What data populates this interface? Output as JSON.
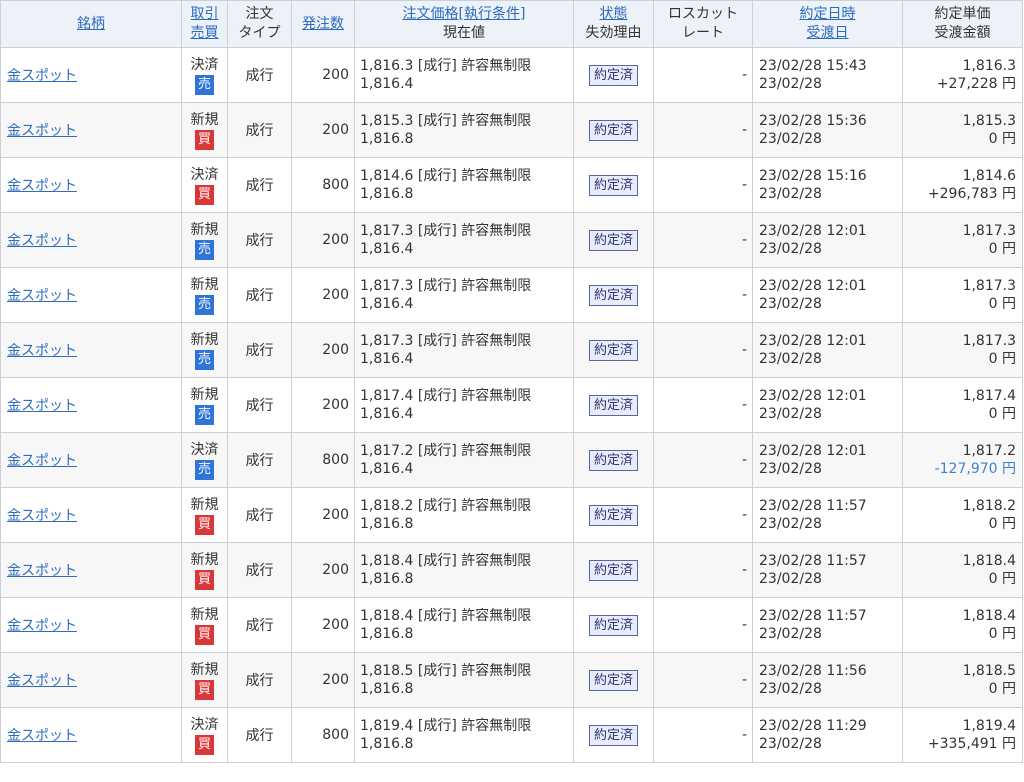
{
  "headers": {
    "symbol": "銘柄",
    "trade_line1": "取引",
    "trade_line2": "売買",
    "type_line1": "注文",
    "type_line2": "タイプ",
    "qty": "発注数",
    "price_line1": "注文価格[執行条件]",
    "price_line2": "現在値",
    "status_line1": "状態",
    "status_line2": "失効理由",
    "loss_line1": "ロスカット",
    "loss_line2": "レート",
    "date_line1": "約定日時",
    "date_line2": "受渡日",
    "amt_line1": "約定単価",
    "amt_line2": "受渡金額"
  },
  "colors": {
    "sell_badge": "#2f74d6",
    "buy_badge": "#d9383a",
    "link": "#2d6cc0",
    "negative": "#3b82d6"
  },
  "rows": [
    {
      "symbol": "金スポット",
      "trade": "決済",
      "side": "売",
      "side_type": "sell",
      "order_type": "成行",
      "qty": "200",
      "order_price": "1,816.3 [成行] 許容無制限",
      "current": "1,816.4",
      "status": "約定済",
      "losscut": "-",
      "exec_datetime": "23/02/28 15:43",
      "settle_date": "23/02/28",
      "unit_price": "1,816.3",
      "settle_amount": "+27,228 円",
      "neg": false
    },
    {
      "symbol": "金スポット",
      "trade": "新規",
      "side": "買",
      "side_type": "buy",
      "order_type": "成行",
      "qty": "200",
      "order_price": "1,815.3 [成行] 許容無制限",
      "current": "1,816.8",
      "status": "約定済",
      "losscut": "-",
      "exec_datetime": "23/02/28 15:36",
      "settle_date": "23/02/28",
      "unit_price": "1,815.3",
      "settle_amount": "0 円",
      "neg": false
    },
    {
      "symbol": "金スポット",
      "trade": "決済",
      "side": "買",
      "side_type": "buy",
      "order_type": "成行",
      "qty": "800",
      "order_price": "1,814.6 [成行] 許容無制限",
      "current": "1,816.8",
      "status": "約定済",
      "losscut": "-",
      "exec_datetime": "23/02/28 15:16",
      "settle_date": "23/02/28",
      "unit_price": "1,814.6",
      "settle_amount": "+296,783 円",
      "neg": false
    },
    {
      "symbol": "金スポット",
      "trade": "新規",
      "side": "売",
      "side_type": "sell",
      "order_type": "成行",
      "qty": "200",
      "order_price": "1,817.3 [成行] 許容無制限",
      "current": "1,816.4",
      "status": "約定済",
      "losscut": "-",
      "exec_datetime": "23/02/28 12:01",
      "settle_date": "23/02/28",
      "unit_price": "1,817.3",
      "settle_amount": "0 円",
      "neg": false
    },
    {
      "symbol": "金スポット",
      "trade": "新規",
      "side": "売",
      "side_type": "sell",
      "order_type": "成行",
      "qty": "200",
      "order_price": "1,817.3 [成行] 許容無制限",
      "current": "1,816.4",
      "status": "約定済",
      "losscut": "-",
      "exec_datetime": "23/02/28 12:01",
      "settle_date": "23/02/28",
      "unit_price": "1,817.3",
      "settle_amount": "0 円",
      "neg": false
    },
    {
      "symbol": "金スポット",
      "trade": "新規",
      "side": "売",
      "side_type": "sell",
      "order_type": "成行",
      "qty": "200",
      "order_price": "1,817.3 [成行] 許容無制限",
      "current": "1,816.4",
      "status": "約定済",
      "losscut": "-",
      "exec_datetime": "23/02/28 12:01",
      "settle_date": "23/02/28",
      "unit_price": "1,817.3",
      "settle_amount": "0 円",
      "neg": false
    },
    {
      "symbol": "金スポット",
      "trade": "新規",
      "side": "売",
      "side_type": "sell",
      "order_type": "成行",
      "qty": "200",
      "order_price": "1,817.4 [成行] 許容無制限",
      "current": "1,816.4",
      "status": "約定済",
      "losscut": "-",
      "exec_datetime": "23/02/28 12:01",
      "settle_date": "23/02/28",
      "unit_price": "1,817.4",
      "settle_amount": "0 円",
      "neg": false
    },
    {
      "symbol": "金スポット",
      "trade": "決済",
      "side": "売",
      "side_type": "sell",
      "order_type": "成行",
      "qty": "800",
      "order_price": "1,817.2 [成行] 許容無制限",
      "current": "1,816.4",
      "status": "約定済",
      "losscut": "-",
      "exec_datetime": "23/02/28 12:01",
      "settle_date": "23/02/28",
      "unit_price": "1,817.2",
      "settle_amount": "-127,970 円",
      "neg": true
    },
    {
      "symbol": "金スポット",
      "trade": "新規",
      "side": "買",
      "side_type": "buy",
      "order_type": "成行",
      "qty": "200",
      "order_price": "1,818.2 [成行] 許容無制限",
      "current": "1,816.8",
      "status": "約定済",
      "losscut": "-",
      "exec_datetime": "23/02/28 11:57",
      "settle_date": "23/02/28",
      "unit_price": "1,818.2",
      "settle_amount": "0 円",
      "neg": false
    },
    {
      "symbol": "金スポット",
      "trade": "新規",
      "side": "買",
      "side_type": "buy",
      "order_type": "成行",
      "qty": "200",
      "order_price": "1,818.4 [成行] 許容無制限",
      "current": "1,816.8",
      "status": "約定済",
      "losscut": "-",
      "exec_datetime": "23/02/28 11:57",
      "settle_date": "23/02/28",
      "unit_price": "1,818.4",
      "settle_amount": "0 円",
      "neg": false
    },
    {
      "symbol": "金スポット",
      "trade": "新規",
      "side": "買",
      "side_type": "buy",
      "order_type": "成行",
      "qty": "200",
      "order_price": "1,818.4 [成行] 許容無制限",
      "current": "1,816.8",
      "status": "約定済",
      "losscut": "-",
      "exec_datetime": "23/02/28 11:57",
      "settle_date": "23/02/28",
      "unit_price": "1,818.4",
      "settle_amount": "0 円",
      "neg": false
    },
    {
      "symbol": "金スポット",
      "trade": "新規",
      "side": "買",
      "side_type": "buy",
      "order_type": "成行",
      "qty": "200",
      "order_price": "1,818.5 [成行] 許容無制限",
      "current": "1,816.8",
      "status": "約定済",
      "losscut": "-",
      "exec_datetime": "23/02/28 11:56",
      "settle_date": "23/02/28",
      "unit_price": "1,818.5",
      "settle_amount": "0 円",
      "neg": false
    },
    {
      "symbol": "金スポット",
      "trade": "決済",
      "side": "買",
      "side_type": "buy",
      "order_type": "成行",
      "qty": "800",
      "order_price": "1,819.4 [成行] 許容無制限",
      "current": "1,816.8",
      "status": "約定済",
      "losscut": "-",
      "exec_datetime": "23/02/28 11:29",
      "settle_date": "23/02/28",
      "unit_price": "1,819.4",
      "settle_amount": "+335,491 円",
      "neg": false
    }
  ]
}
